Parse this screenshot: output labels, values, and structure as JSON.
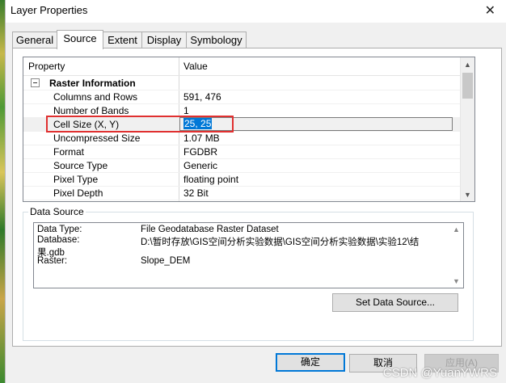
{
  "window": {
    "title": "Layer Properties",
    "close_glyph": "✕"
  },
  "tabs": [
    {
      "label": "General"
    },
    {
      "label": "Source"
    },
    {
      "label": "Extent"
    },
    {
      "label": "Display"
    },
    {
      "label": "Symbology"
    }
  ],
  "property_grid": {
    "header": {
      "property": "Property",
      "value": "Value"
    },
    "group": {
      "label": "Raster Information",
      "expanded": true
    },
    "rows": [
      {
        "key": "Columns and Rows",
        "value": "591, 476"
      },
      {
        "key": "Number of Bands",
        "value": "1"
      },
      {
        "key": "Cell Size (X, Y)",
        "value": "25, 25"
      },
      {
        "key": "Uncompressed Size",
        "value": "1.07 MB"
      },
      {
        "key": "Format",
        "value": "FGDBR"
      },
      {
        "key": "Source Type",
        "value": "Generic"
      },
      {
        "key": "Pixel Type",
        "value": "floating point"
      },
      {
        "key": "Pixel Depth",
        "value": "32 Bit"
      }
    ]
  },
  "data_source": {
    "legend": "Data Source",
    "lines": [
      {
        "label": "Data Type:",
        "value": "File Geodatabase Raster Dataset"
      },
      {
        "label": "Database:",
        "value": "D:\\暂时存放\\GIS空间分析实验数据\\GIS空间分析实验数据\\实验12\\结"
      },
      {
        "label": "果.gdb",
        "value": ""
      },
      {
        "label": "Raster:",
        "value": "Slope_DEM"
      }
    ],
    "set_source_button": "Set Data Source..."
  },
  "buttons": {
    "ok": "确定",
    "cancel": "取消",
    "apply": "应用(A)"
  },
  "watermark": "CSDN @YuanYWRS",
  "colors": {
    "selection": "#0078d7",
    "highlight_border": "#e03030"
  }
}
